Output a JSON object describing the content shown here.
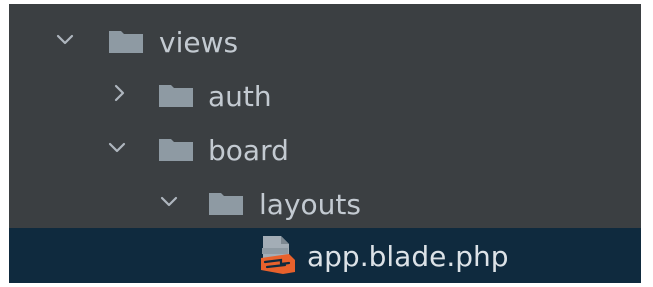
{
  "project_tree": {
    "rows": [
      {
        "label": "views",
        "kind": "folder",
        "state": "expanded",
        "icon": "folder-icon"
      },
      {
        "label": "auth",
        "kind": "folder",
        "state": "collapsed",
        "icon": "folder-icon"
      },
      {
        "label": "board",
        "kind": "folder",
        "state": "expanded",
        "icon": "folder-icon"
      },
      {
        "label": "layouts",
        "kind": "folder",
        "state": "expanded",
        "icon": "folder-icon"
      },
      {
        "label": "app.blade.php",
        "kind": "file",
        "state": "selected",
        "icon": "blade-file-icon"
      }
    ]
  },
  "colors": {
    "panel_background": "#3b3f42",
    "selected_row": "#0f2a3e",
    "text": "#c3cad1",
    "folder": "#8e9aa3",
    "blade_accent": "#e8612c"
  }
}
